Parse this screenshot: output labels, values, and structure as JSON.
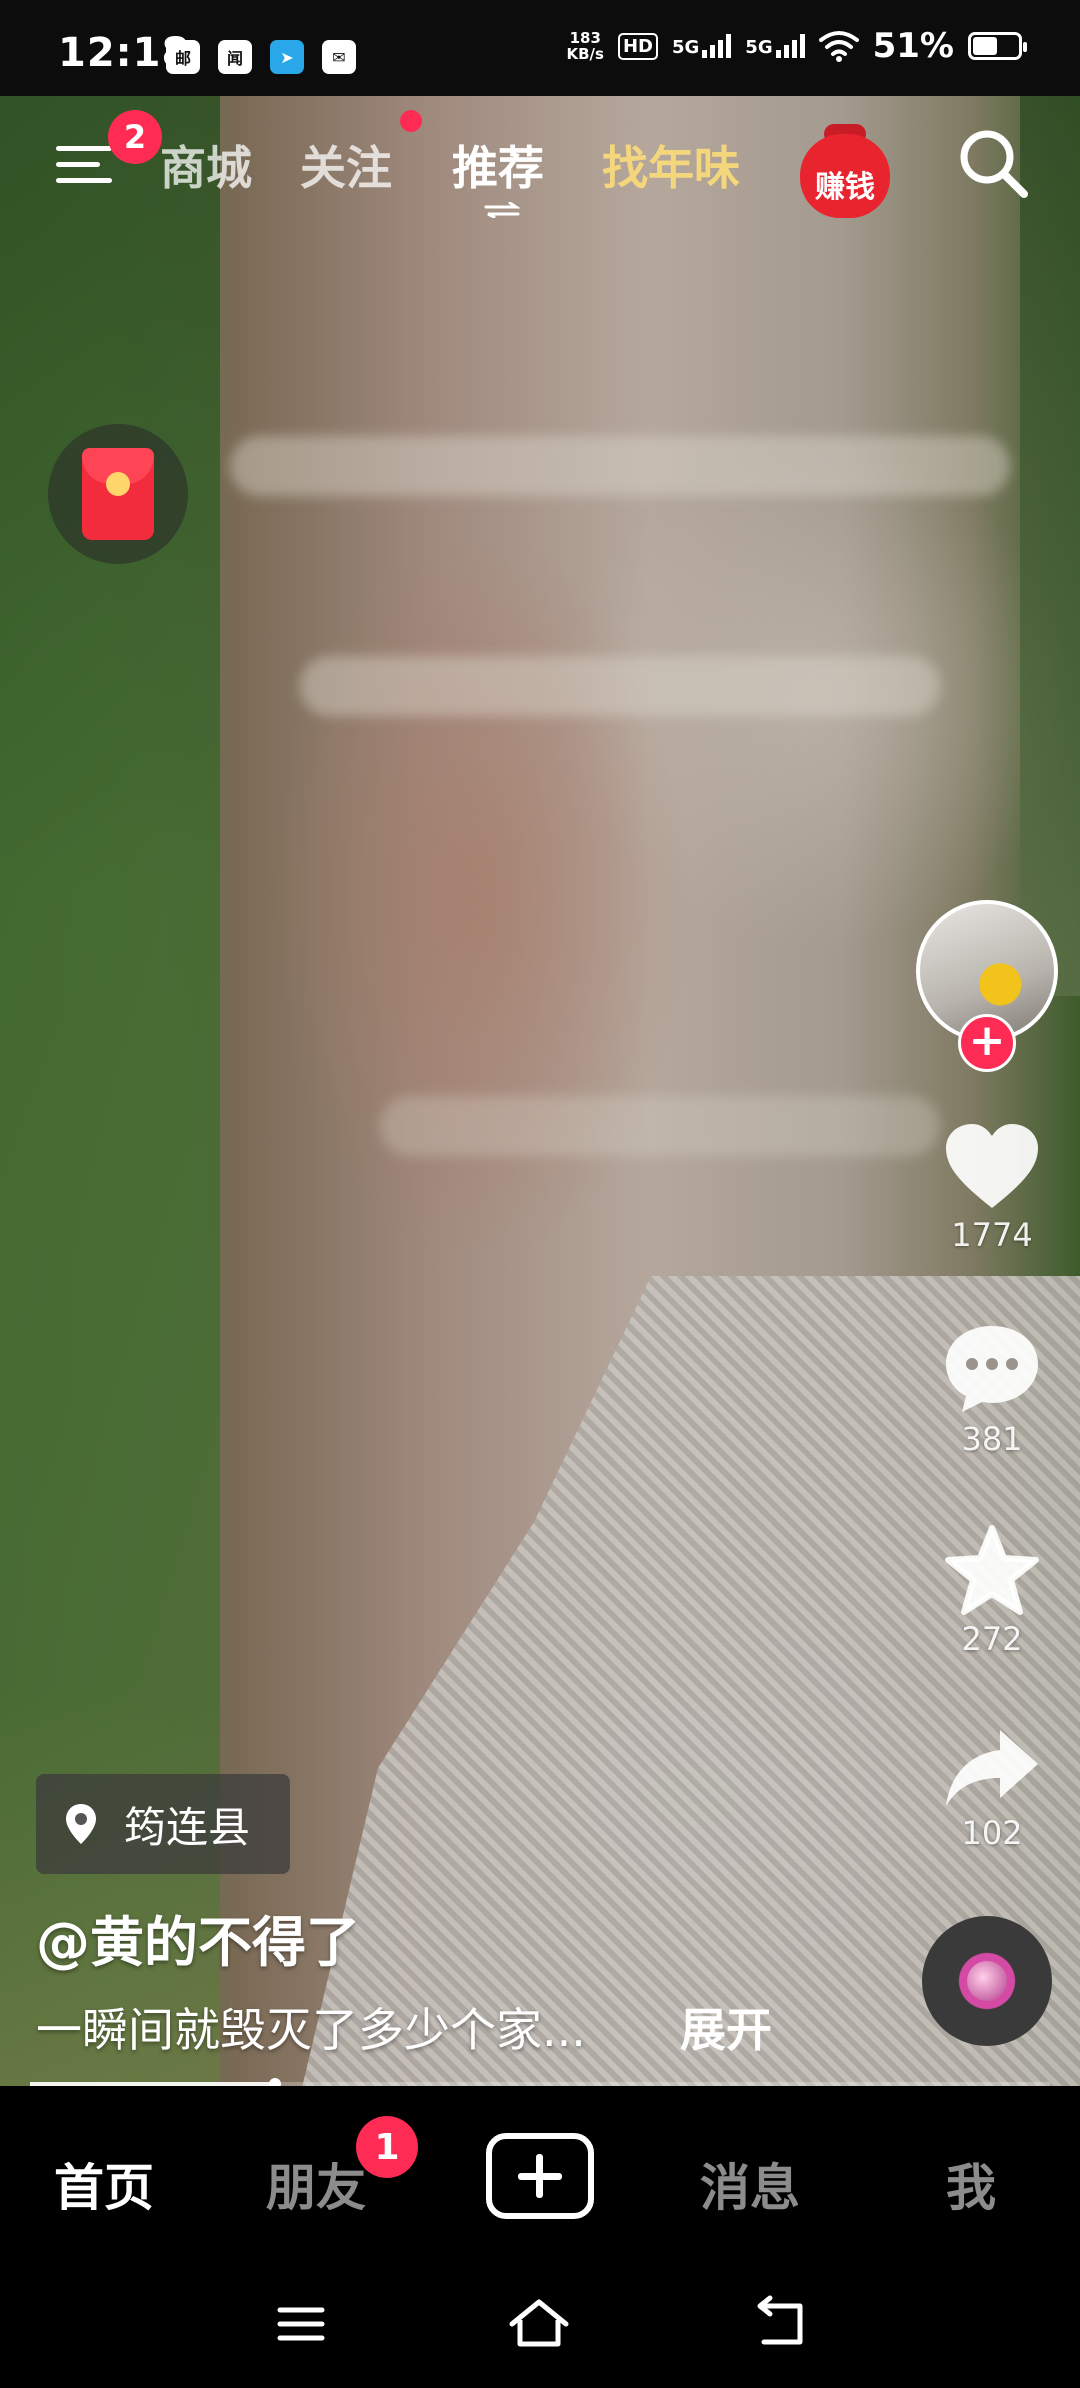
{
  "status_bar": {
    "time": "12:18",
    "speed_value": "183",
    "speed_unit": "KB/s",
    "hd_label": "HD",
    "net1": "5G",
    "net2": "5G",
    "battery": "51%",
    "battery_level": 0.51
  },
  "top_nav": {
    "menu_badge": "2",
    "tabs": [
      "商城",
      "关注",
      "推荐",
      "找年味"
    ],
    "active_tab": "推荐",
    "earn_label": "赚钱"
  },
  "post": {
    "location": "筠连县",
    "author": "@黄的不得了",
    "description": "一瞬间就毁灭了多少个家...",
    "expand_label": "展开",
    "progress": 0.24
  },
  "actions": {
    "likes": "1774",
    "comments": "381",
    "favorites": "272",
    "shares": "102"
  },
  "bottom_tabs": {
    "home": "首页",
    "friends": "朋友",
    "friends_badge": "1",
    "messages": "消息",
    "me": "我"
  },
  "colors": {
    "accent": "#fe2c55",
    "gold_tab": "#f4d77c",
    "background": "#000000"
  }
}
